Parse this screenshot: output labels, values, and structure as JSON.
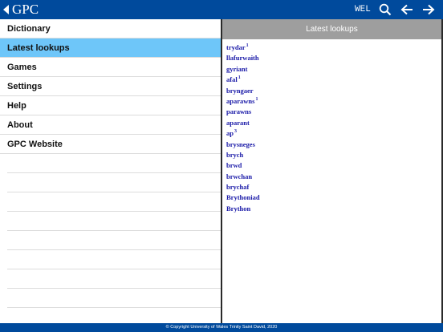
{
  "topbar": {
    "app_title": "GPC",
    "language": "WEL",
    "icons": [
      "back-caret-icon",
      "search-icon",
      "arrow-left-icon",
      "arrow-right-icon"
    ]
  },
  "sidebar": {
    "items": [
      {
        "label": "Dictionary",
        "active": false
      },
      {
        "label": "Latest lookups",
        "active": true
      },
      {
        "label": "Games",
        "active": false
      },
      {
        "label": "Settings",
        "active": false
      },
      {
        "label": "Help",
        "active": false
      },
      {
        "label": "About",
        "active": false
      },
      {
        "label": "GPC Website",
        "active": false
      }
    ]
  },
  "panel": {
    "title": "Latest lookups",
    "lookups": [
      {
        "word": "trydar",
        "sup": "1"
      },
      {
        "word": "llafurwaith",
        "sup": ""
      },
      {
        "word": "gyriant",
        "sup": ""
      },
      {
        "word": "afal",
        "sup": "1"
      },
      {
        "word": "bryngaer",
        "sup": ""
      },
      {
        "word": "aparawns",
        "sup": "1"
      },
      {
        "word": "parawns",
        "sup": ""
      },
      {
        "word": "aparant",
        "sup": ""
      },
      {
        "word": "ap",
        "sup": "3"
      },
      {
        "word": "brysneges",
        "sup": ""
      },
      {
        "word": "brych",
        "sup": ""
      },
      {
        "word": "brwd",
        "sup": ""
      },
      {
        "word": "brwchan",
        "sup": ""
      },
      {
        "word": "brychaf",
        "sup": ""
      },
      {
        "word": "Brythoniad",
        "sup": ""
      },
      {
        "word": "Brython",
        "sup": ""
      }
    ]
  },
  "footer": {
    "copyright": "© Copyright University of Wales Trinity Saint David, 2020"
  },
  "colors": {
    "header_blue": "#004a9c",
    "active_item": "#6ec6f9",
    "panel_header_gray": "#9e9e9e",
    "link_blue": "#1a1aa8"
  }
}
